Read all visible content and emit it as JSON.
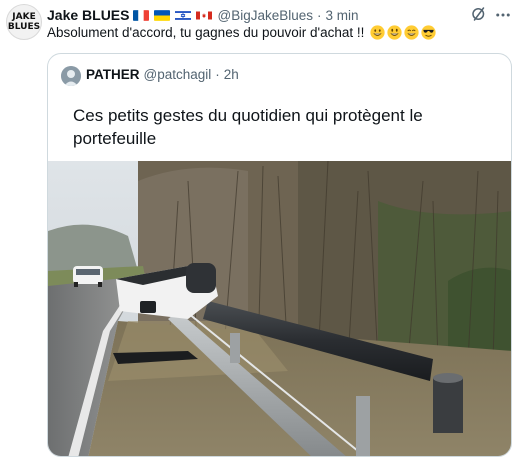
{
  "tweet": {
    "avatar_text_line1": "JAKE",
    "avatar_text_line2": "BLUES",
    "author_name": "Jake BLUES",
    "flags": [
      "flag-france",
      "flag-ukraine",
      "flag-israel",
      "flag-canada"
    ],
    "handle": "@BigJakeBlues",
    "separator": "·",
    "time": "3 min",
    "text": "Absolument d'accord, tu gagnes du pouvoir d'achat !!",
    "emojis": [
      "grinning-face-icon",
      "grinning-face-icon",
      "grinning-face-icon",
      "sunglasses-face-icon"
    ]
  },
  "icons": {
    "grok": "grok-icon",
    "more": "more-icon"
  },
  "quote": {
    "author_name": "PATHER",
    "handle": "@patchagil",
    "separator": "·",
    "time": "2h",
    "text": "Ces petits gestes du quotidien qui protègent le portefeuille",
    "image": "toppled-speed-camera-photo"
  },
  "colors": {
    "text_primary": "#0f1419",
    "text_secondary": "#536471",
    "border": "#cfd9de"
  }
}
